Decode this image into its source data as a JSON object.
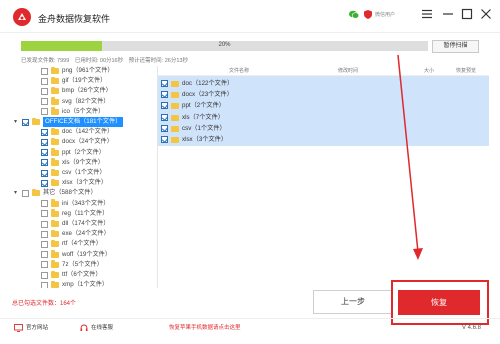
{
  "app": {
    "title": "金舟数据恢复软件",
    "user_label": "微信用户",
    "version": "V 4.6.8"
  },
  "progress": {
    "percent_label": "20%",
    "value": 0.2,
    "pause_label": "暂停扫描",
    "found_files": "已发现文件数: 7999",
    "elapsed": "已用时间: 00分16秒",
    "remaining": "预计还需时间: 26分13秒"
  },
  "tree": [
    {
      "label": "png（961个文件）",
      "checked": false,
      "indent": 1
    },
    {
      "label": "gif（19个文件）",
      "checked": false,
      "indent": 1
    },
    {
      "label": "bmp（26个文件）",
      "checked": false,
      "indent": 1
    },
    {
      "label": "svg（82个文件）",
      "checked": false,
      "indent": 1
    },
    {
      "label": "ico（5个文件）",
      "checked": false,
      "indent": 1
    },
    {
      "label": "OFFICE文档（181个文件）",
      "checked": true,
      "indent": 0,
      "selected": true,
      "expanded": true
    },
    {
      "label": "doc（142个文件）",
      "checked": true,
      "indent": 1
    },
    {
      "label": "docx（24个文件）",
      "checked": true,
      "indent": 1
    },
    {
      "label": "ppt（2个文件）",
      "checked": true,
      "indent": 1
    },
    {
      "label": "xls（9个文件）",
      "checked": true,
      "indent": 1
    },
    {
      "label": "csv（1个文件）",
      "checked": true,
      "indent": 1
    },
    {
      "label": "xlsx（3个文件）",
      "checked": true,
      "indent": 1
    },
    {
      "label": "其它（588个文件）",
      "checked": false,
      "indent": 0,
      "expanded": true
    },
    {
      "label": "ini（343个文件）",
      "checked": false,
      "indent": 1
    },
    {
      "label": "reg（11个文件）",
      "checked": false,
      "indent": 1
    },
    {
      "label": "dll（174个文件）",
      "checked": false,
      "indent": 1
    },
    {
      "label": "exe（24个文件）",
      "checked": false,
      "indent": 1
    },
    {
      "label": "rtf（4个文件）",
      "checked": false,
      "indent": 1
    },
    {
      "label": "woff（19个文件）",
      "checked": false,
      "indent": 1
    },
    {
      "label": "7z（5个文件）",
      "checked": false,
      "indent": 1
    },
    {
      "label": "ttf（6个文件）",
      "checked": false,
      "indent": 1
    },
    {
      "label": "xmp（1个文件）",
      "checked": false,
      "indent": 1
    },
    {
      "label": "prproj（1个文件）",
      "checked": false,
      "indent": 1
    }
  ],
  "table": {
    "headers": [
      "文件名称",
      "修改时间",
      "大小",
      "恢复预览"
    ],
    "rows": [
      {
        "name": "doc（122个文件）"
      },
      {
        "name": "docx（23个文件）"
      },
      {
        "name": "ppt（2个文件）"
      },
      {
        "name": "xls（7个文件）"
      },
      {
        "name": "csv（1个文件）"
      },
      {
        "name": "xlsx（3个文件）"
      }
    ]
  },
  "bottom": {
    "selected_count": "总已勾选文件数：164个",
    "prev_label": "上一步",
    "recover_label": "恢复"
  },
  "footer": {
    "website": "官方网站",
    "service": "在线客服",
    "promo": "恢复苹果手机数据请点击这里"
  },
  "colors": {
    "brand_red": "#e0292d",
    "progress_green": "#9bd341",
    "selection_blue": "#1e90ff",
    "folder_yellow": "#f4c542"
  }
}
